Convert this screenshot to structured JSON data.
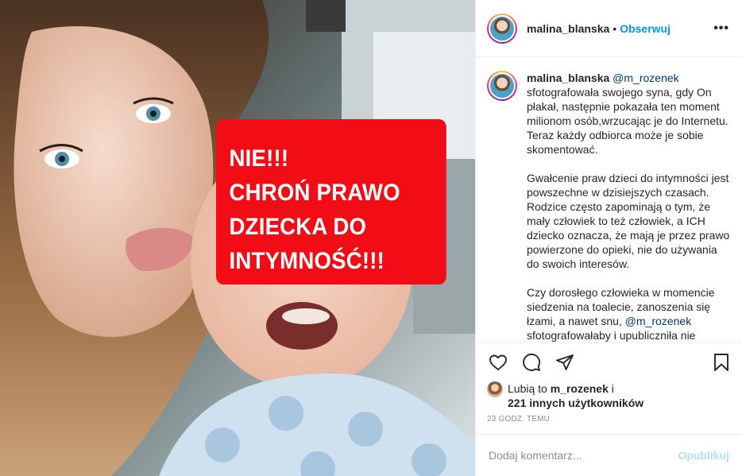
{
  "header": {
    "username": "malina_blanska",
    "separator": "•",
    "follow_label": "Obserwuj",
    "more_label": "•••"
  },
  "photo": {
    "sticker_lines": [
      "NIE!!!",
      "CHROŃ PRAWO",
      "DZIECKA DO",
      "INTYMNOŚĆ!!!"
    ],
    "sticker_color": "#f20d16"
  },
  "caption": {
    "username": "malina_blanska",
    "mention_1": "@m_rozenek",
    "p1": " sfotografowała swojego syna, gdy On płakał, następnie pokazała ten moment milionom osób,wrzucając je do Internetu. Teraz każdy odbiorca może je sobie skomentować.",
    "p2": "Gwałcenie praw dzieci do intymności jest powszechne w dzisiejszych czasach. Rodzice często zapominają o tym, że mały człowiek to też człowiek, a ICH dziecko oznacza, że mają je przez prawo powierzone do opieki, nie do używania do swoich interesów.",
    "p3a": "Czy dorosłego człowieka w momencie siedzenia na toalecie, zanoszenia się łzami, a nawet snu, ",
    "mention_2": "@m_rozenek",
    "p3b": " sfotografowałaby i upubliczniła nie"
  },
  "actions": {
    "like_icon": "heart-icon",
    "comment_icon": "comment-icon",
    "share_icon": "share-icon",
    "save_icon": "bookmark-icon"
  },
  "likes": {
    "prefix": "Lubią to ",
    "liker": "m_rozenek",
    "and": " i",
    "others": "221 innych użytkowników"
  },
  "timestamp": "23 godz. temu",
  "comment": {
    "placeholder": "Dodaj komentarz...",
    "post_label": "Opublikuj"
  },
  "colors": {
    "accent": "#0095f6",
    "post_disabled": "#b2dffc",
    "muted": "#8e8e8e",
    "mention": "#00376b"
  }
}
